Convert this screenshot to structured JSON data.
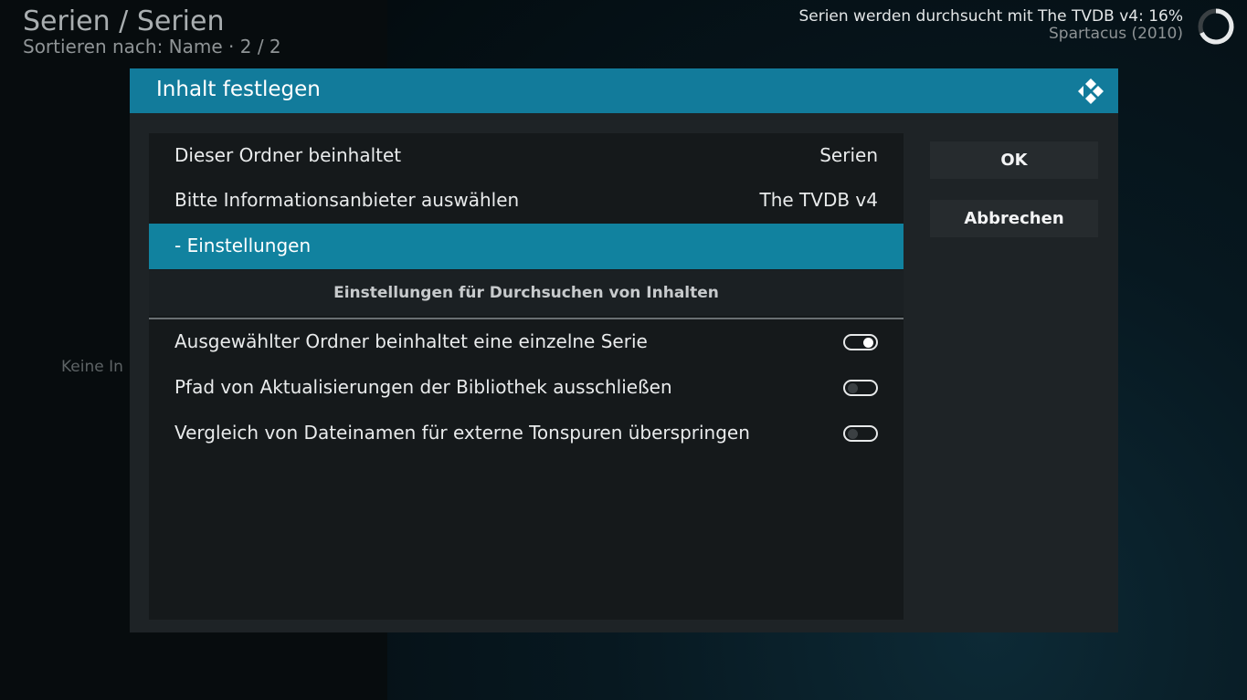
{
  "background": {
    "title": "Serien / Serien",
    "subtitle": "Sortieren nach: Name  ·  2 / 2",
    "empty_text": "Keine In"
  },
  "scan_status": {
    "line1": "Serien werden durchsucht mit The TVDB v4: 16%",
    "line2": "Spartacus (2010)",
    "progress_percent": 16
  },
  "dialog": {
    "title": "Inhalt festlegen",
    "rows": [
      {
        "label": "Dieser Ordner beinhaltet",
        "value": "Serien"
      },
      {
        "label": "Bitte Informationsanbieter auswählen",
        "value": "The TVDB v4"
      },
      {
        "label": "- Einstellungen",
        "selected": true
      }
    ],
    "section_title": "Einstellungen für Durchsuchen von Inhalten",
    "toggles": [
      {
        "label": "Ausgewählter Ordner beinhaltet eine einzelne Serie",
        "on": true
      },
      {
        "label": "Pfad von Aktualisierungen der Bibliothek ausschließen",
        "on": false
      },
      {
        "label": "Vergleich von Dateinamen für externe Tonspuren überspringen",
        "on": false
      }
    ],
    "buttons": {
      "ok": "OK",
      "cancel": "Abbrechen"
    }
  },
  "colors": {
    "accent": "#127b9b",
    "selected": "#11829f"
  },
  "icons": {
    "logo": "kodi-logo-icon",
    "spinner": "busy-spinner-icon"
  }
}
